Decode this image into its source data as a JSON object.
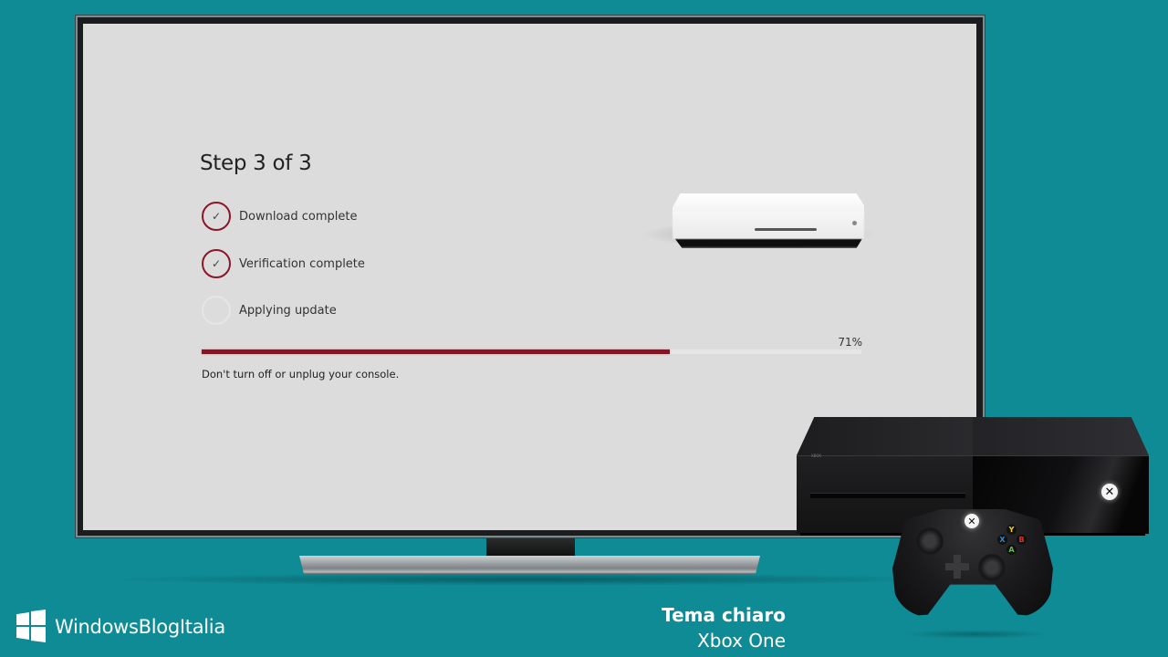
{
  "update_screen": {
    "title": "Step 3 of 3",
    "steps": [
      {
        "label": "Download complete",
        "status": "complete",
        "icon": "checkmark-icon"
      },
      {
        "label": "Verification complete",
        "status": "complete",
        "icon": "checkmark-icon"
      },
      {
        "label": "Applying update",
        "status": "in-progress",
        "icon": "empty-circle-icon"
      }
    ],
    "check_glyph": "✓",
    "progress": {
      "percent": 71,
      "label": "71%"
    },
    "warning": "Don't turn off or unplug your console.",
    "accent_color": "#8f1022",
    "background_color": "#dcdcdc"
  },
  "console_brand": "XBOX",
  "controller_buttons": {
    "y": "Y",
    "x": "X",
    "b": "B",
    "a": "A"
  },
  "xbox_logo_glyph": "✕",
  "branding": {
    "site_name": "WindowsBlogItalia",
    "caption_title": "Tema chiaro",
    "caption_subtitle": "Xbox One",
    "background_color": "#0f8b95"
  }
}
